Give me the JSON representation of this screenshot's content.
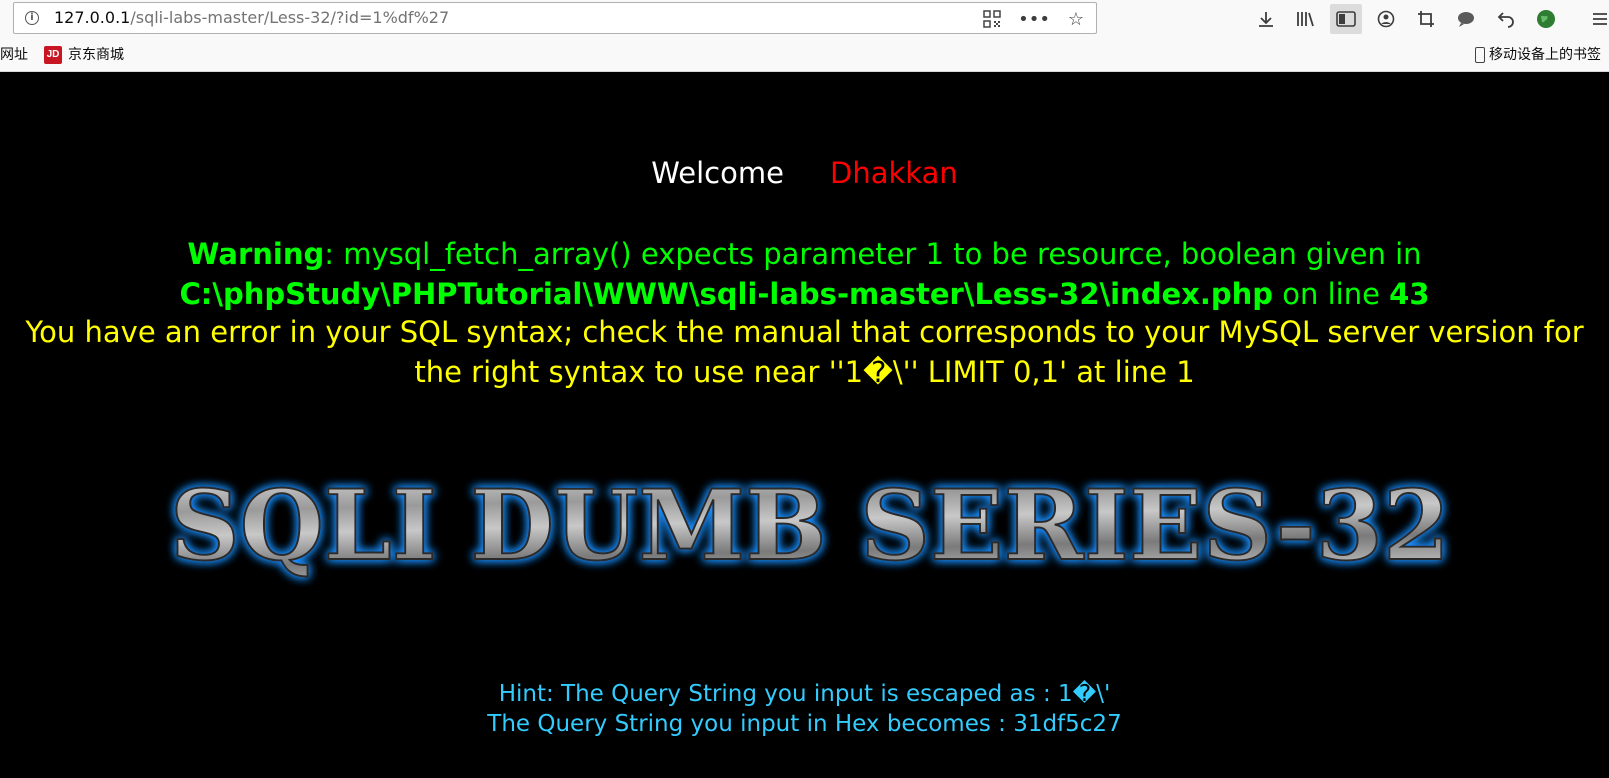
{
  "browser": {
    "url_host": "127.0.0.1",
    "url_path": "/sqli-labs-master/Less-32/?id=1%df%27",
    "bookmarks": {
      "item1": "网址",
      "item2_icon_text": "JD",
      "item2": "京东商城",
      "mobile": "移动设备上的书签"
    }
  },
  "page": {
    "welcome_label": "Welcome",
    "welcome_name": "Dhakkan",
    "warning": {
      "label": "Warning",
      "message": ": mysql_fetch_array() expects parameter 1 to be resource, boolean given in ",
      "path": "C:\\phpStudy\\PHPTutorial\\WWW\\sqli-labs-master\\Less-32\\index.php",
      "on_line": " on line ",
      "line": "43"
    },
    "sql_error": "You have an error in your SQL syntax; check the manual that corresponds to your MySQL server version for the right syntax to use near ''1�\\'' LIMIT 0,1' at line 1",
    "banner_text": "SQLI DUMB SERIES-32",
    "hint_line1": "Hint: The Query String you input is escaped as : 1�\\'",
    "hint_line2": "The Query String you input in Hex becomes : 31df5c27"
  },
  "colors": {
    "background": "#000000",
    "warning_green": "#00ff00",
    "error_yellow": "#ffff00",
    "welcome_name_red": "#ff0000",
    "hint_cyan": "#33ccff",
    "banner_glow": "#1e90ff"
  }
}
